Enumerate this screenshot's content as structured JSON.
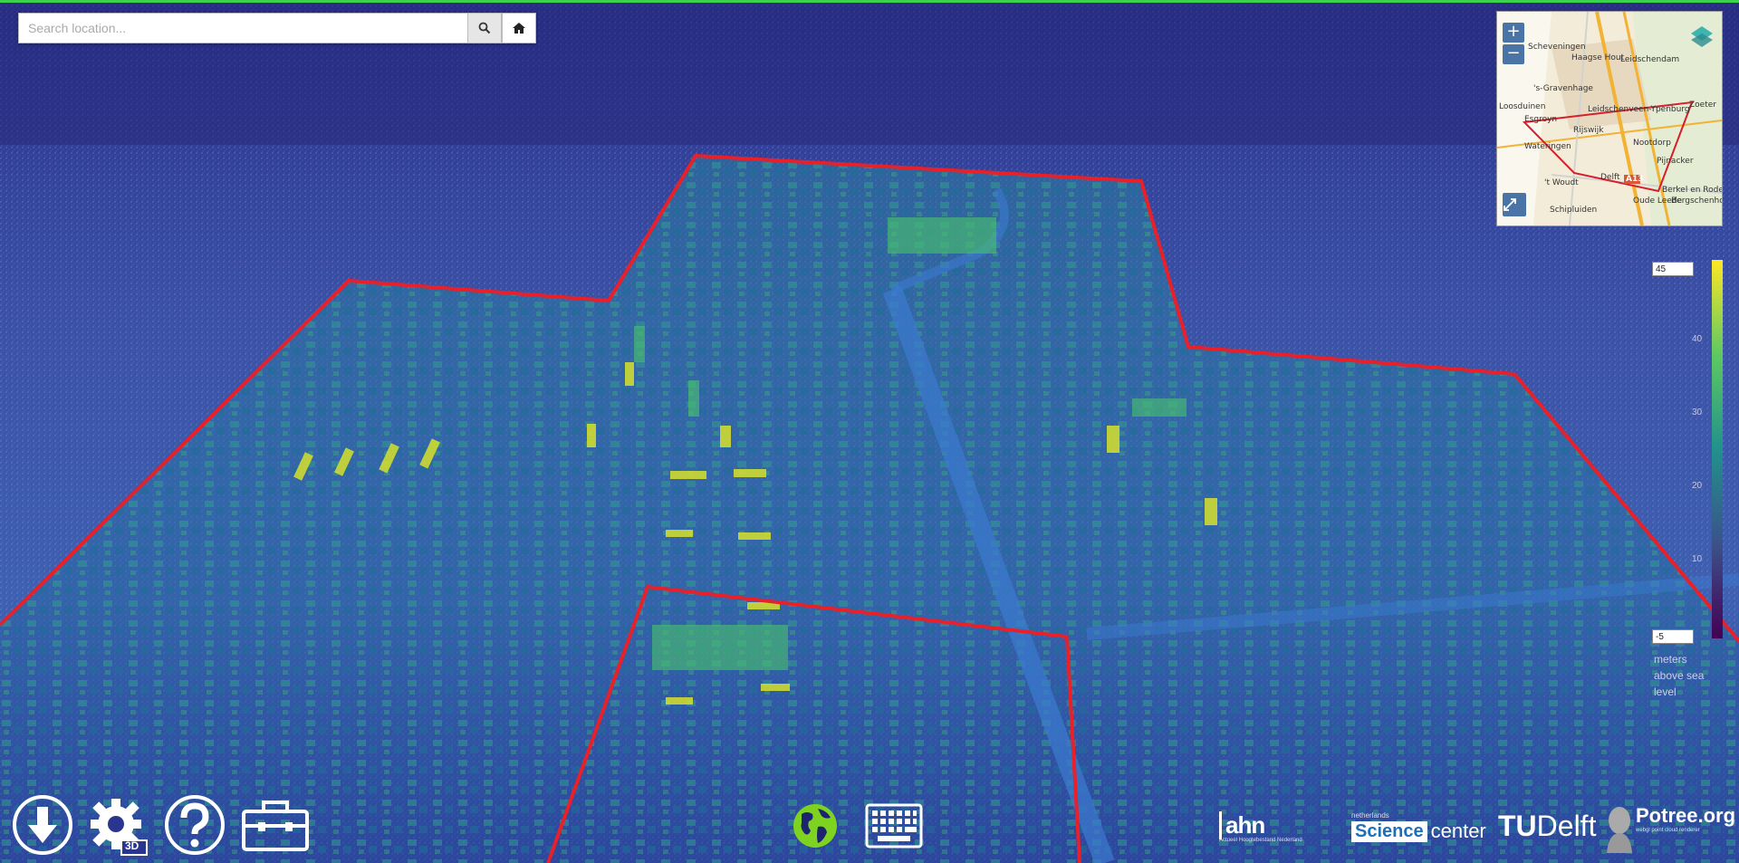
{
  "search": {
    "placeholder": "Search location..."
  },
  "minimap": {
    "zoom_in": "+",
    "zoom_out": "−",
    "places": [
      "Scheveningen",
      "Haagse Hout",
      "Leidschendam",
      "'s-Gravenhage",
      "Zoeter",
      "Loosduinen",
      "Leidschenveen-Ypenburg",
      "Esgroyn",
      "Rijswijk",
      "Wateringen",
      "Nootdorp",
      "Pijnacker",
      "'t Woudt",
      "Delft",
      "Berkel en Rodenrijs",
      "Bergschenhoek",
      "Schipluiden",
      "Oude Leede",
      "A13"
    ]
  },
  "legend": {
    "max": "45",
    "min": "-5",
    "ticks": [
      "40",
      "30",
      "20",
      "10"
    ],
    "unit_line1": "meters",
    "unit_line2": "above sea",
    "unit_line3": "level",
    "colors": [
      "#fde725",
      "#5ec962",
      "#21918c",
      "#3b528b",
      "#440154"
    ]
  },
  "toolbar": {
    "badge_3d": "3D"
  },
  "logos": {
    "ahn": "ahn",
    "ahn_sub": "Actueel Hoogtebestand Nederland",
    "nl_small": "netherlands",
    "science": "Science",
    "center": "center",
    "tu": "TU",
    "delft": "Delft",
    "potree": "Potree.org",
    "potree_sub": "webgl point cloud renderer"
  },
  "colors": {
    "boundary": "#e8202a",
    "accent_green": "#3bd34b",
    "globe": "#7ed321"
  }
}
